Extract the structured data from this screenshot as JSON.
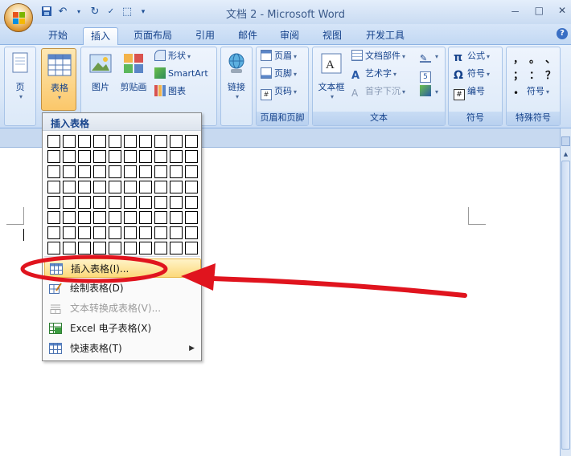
{
  "window": {
    "title": "文档 2 - Microsoft Word",
    "controls": [
      "－",
      "□",
      "✕"
    ]
  },
  "quick_access": [
    "save-icon",
    "undo-icon",
    "redo-icon",
    "spelling-icon",
    "format-painter-icon",
    "customize-icon"
  ],
  "tabs": [
    {
      "label": "开始"
    },
    {
      "label": "插入",
      "active": true
    },
    {
      "label": "页面布局"
    },
    {
      "label": "引用"
    },
    {
      "label": "邮件"
    },
    {
      "label": "审阅"
    },
    {
      "label": "视图"
    },
    {
      "label": "开发工具"
    }
  ],
  "help_label": "?",
  "ribbon": {
    "page_label": "页",
    "table_label": "表格",
    "illustrations": {
      "picture": "图片",
      "clipart": "剪贴画",
      "shapes": "形状",
      "smartart": "SmartArt",
      "chart": "图表"
    },
    "link_label": "链接",
    "header_footer": {
      "header": "页眉",
      "footer": "页脚",
      "page_number": "页码",
      "group_label": "页眉和页脚"
    },
    "text": {
      "textbox": "文本框",
      "quick_parts": "文档部件",
      "wordart": "艺术字",
      "dropcap": "首字下沉",
      "group_label": "文本"
    },
    "symbols": {
      "equation": "公式",
      "symbol": "符号",
      "numbering": "编号",
      "group_label": "符号"
    },
    "special": {
      "chars": [
        "，",
        "。",
        "、",
        "；",
        "：",
        "？"
      ],
      "symbol": "符号",
      "group_label": "特殊符号"
    }
  },
  "menu": {
    "header": "插入表格",
    "grid": {
      "cols": 10,
      "rows": 8
    },
    "items": [
      {
        "label": "插入表格(I)...",
        "highlighted": true
      },
      {
        "label": "绘制表格(D)"
      },
      {
        "label": "文本转换成表格(V)...",
        "disabled": true
      },
      {
        "label": "Excel 电子表格(X)"
      },
      {
        "label": "快速表格(T)",
        "submenu": true
      }
    ]
  },
  "annotation_color": "#e0141e"
}
